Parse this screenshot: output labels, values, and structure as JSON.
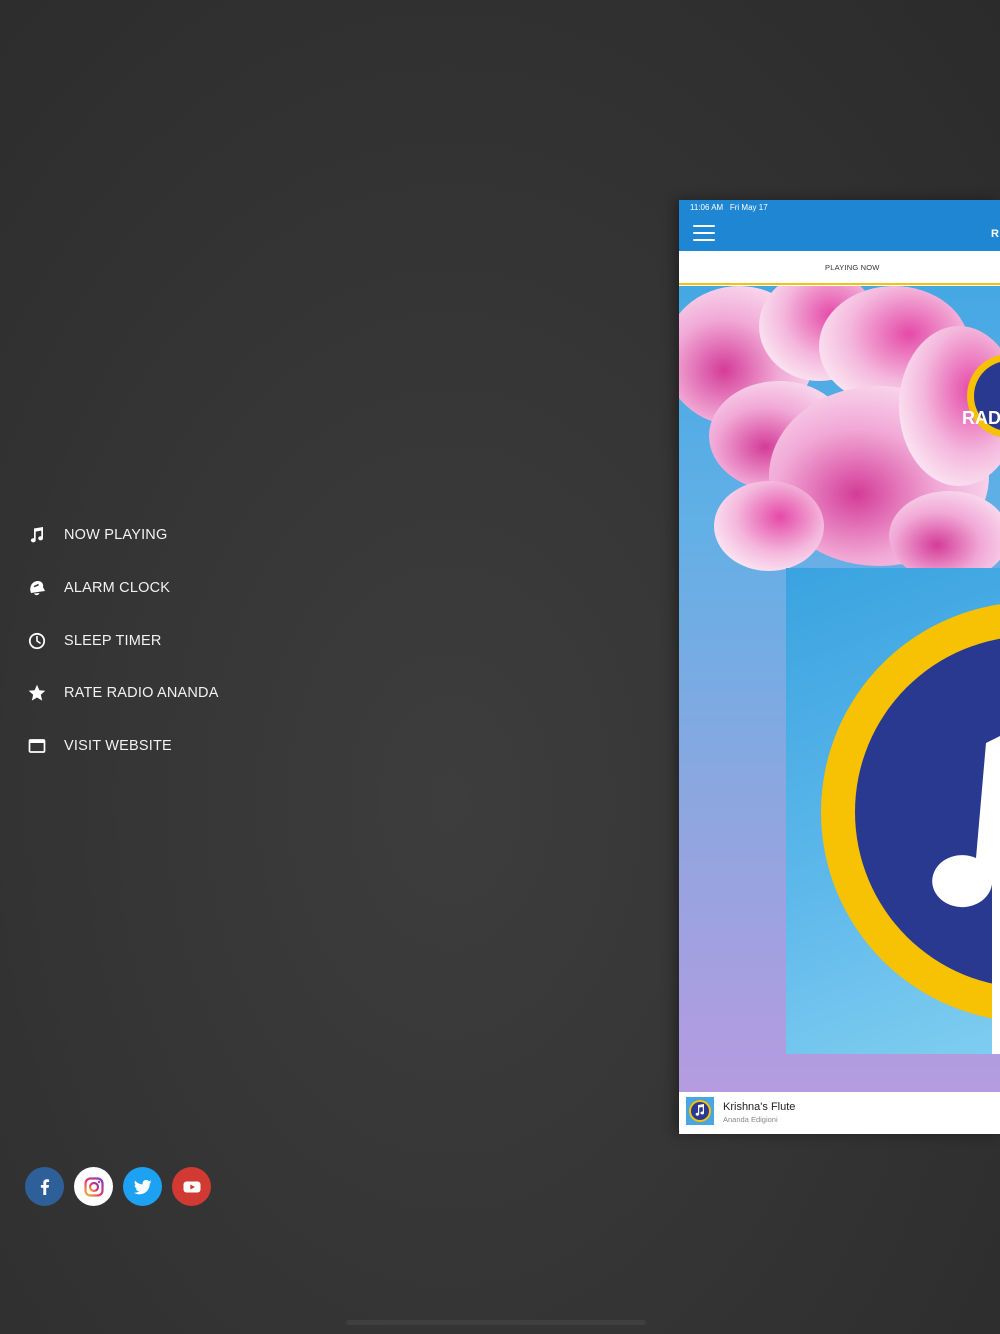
{
  "menu": {
    "items": [
      {
        "label": "NOW PLAYING",
        "icon": "music-note-icon"
      },
      {
        "label": "ALARM CLOCK",
        "icon": "alarm-bell-icon"
      },
      {
        "label": "SLEEP TIMER",
        "icon": "clock-icon"
      },
      {
        "label": "RATE RADIO ANANDA",
        "icon": "star-icon"
      },
      {
        "label": "VISIT WEBSITE",
        "icon": "browser-window-icon"
      }
    ]
  },
  "social": {
    "items": [
      {
        "name": "facebook",
        "icon": "facebook-icon",
        "color": "#2f5f98"
      },
      {
        "name": "instagram",
        "icon": "instagram-icon",
        "color": "#ffffff"
      },
      {
        "name": "twitter",
        "icon": "twitter-icon",
        "color": "#1da1f2"
      },
      {
        "name": "youtube",
        "icon": "youtube-icon",
        "color": "#d13a32"
      }
    ]
  },
  "preview": {
    "status_time": "11:06 AM   Fri May 17",
    "title_fragment": "R",
    "tab_label": "PLAYING NOW",
    "logo_fragment": "RADI",
    "track_title": "Krishna's Flute",
    "track_artist": "Ananda Edigioni",
    "colors": {
      "header_blue": "#1e86d2",
      "accent_yellow": "#f2c30f",
      "logo_navy": "#2a3990"
    }
  }
}
